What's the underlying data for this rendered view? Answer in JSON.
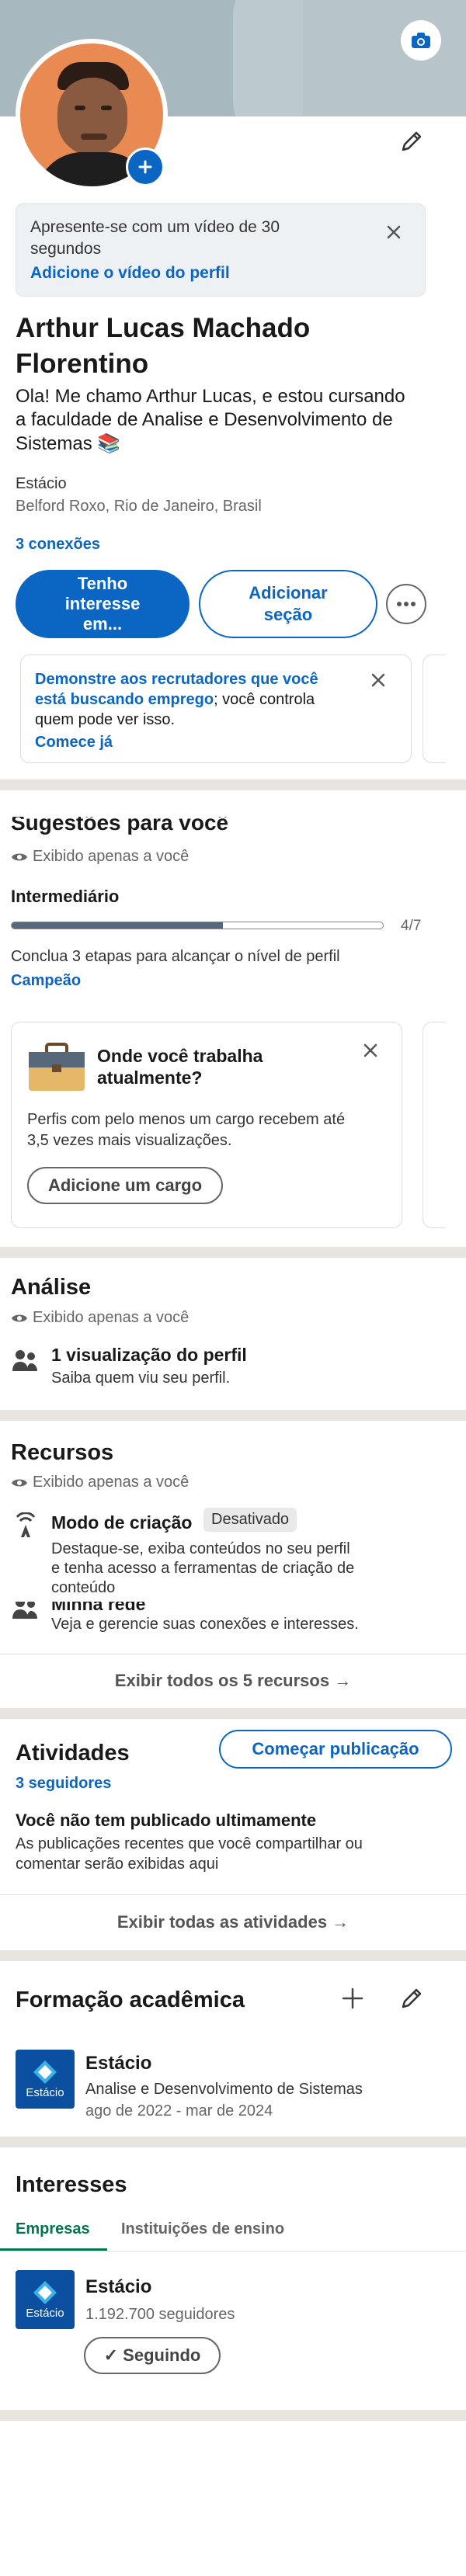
{
  "profile": {
    "name": "Arthur Lucas Machado Florentino",
    "name_line1": "Arthur Lucas Machado",
    "name_line2": "Florentino",
    "headline_line1": "Ola! Me chamo Arthur Lucas, e estou cursando",
    "headline_line2": "a faculdade de Analise e Desenvolvimento de",
    "headline_line3": "Sistemas 📚",
    "company": "Estácio",
    "location": "Belford Roxo, Rio de Janeiro, Brasil",
    "connections": "3 conexões"
  },
  "video_banner": {
    "text_line1": "Apresente-se com um vídeo de 30",
    "text_line2": "segundos",
    "link": "Adicione o vídeo do perfil"
  },
  "actions": {
    "primary_line1": "Tenho",
    "primary_line2": "interesse",
    "primary_line3": "em...",
    "secondary_line1": "Adicionar",
    "secondary_line2": "seção"
  },
  "recruiter_card": {
    "bold_line1": "Demonstre aos recrutadores que você",
    "bold_line2": "está buscando emprego",
    "rest_line2": "; você controla",
    "line3": "quem pode ver isso.",
    "link": "Comece já"
  },
  "suggestions": {
    "title": "Sugestões para você",
    "visibility": "Exibido apenas a você",
    "level": "Intermediário",
    "progress_label": "4/7",
    "progress_value": 0.57,
    "hint": "Conclua 3 etapas para alcançar o nível de perfil",
    "hint_link": "Campeão",
    "card_title_line1": "Onde você trabalha",
    "card_title_line2": "atualmente?",
    "card_body_line1": "Perfis com pelo menos um cargo recebem até",
    "card_body_line2": "3,5 vezes mais visualizações.",
    "card_button": "Adicione um cargo"
  },
  "analytics": {
    "title": "Análise",
    "visibility": "Exibido apenas a você",
    "item_title": "1 visualização do perfil",
    "item_sub": "Saiba quem viu seu perfil."
  },
  "resources": {
    "title": "Recursos",
    "visibility": "Exibido apenas a você",
    "creator_title": "Modo de criação",
    "creator_badge": "Desativado",
    "creator_desc_line1": "Destaque-se, exiba conteúdos no seu perfil",
    "creator_desc_line2": "e tenha acesso a ferramentas de criação de",
    "creator_desc_line3": "conteúdo",
    "network_title": "Minha rede",
    "network_desc": "Veja e gerencie suas conexões e interesses.",
    "show_all": "Exibir todos os 5 recursos →"
  },
  "activity": {
    "title": "Atividades",
    "followers": "3 seguidores",
    "start_post": "Começar publicação",
    "empty_title": "Você não tem publicado ultimamente",
    "empty_line1": "As publicações recentes que você compartilhar ou",
    "empty_line2": "comentar serão exibidas aqui",
    "show_all": "Exibir todas as atividades →"
  },
  "education": {
    "title": "Formação acadêmica",
    "school": "Estácio",
    "course": "Analise e Desenvolvimento de Sistemas",
    "dates": "ago de 2022 - mar de 2024",
    "logo_text": "Estácio"
  },
  "interests": {
    "title": "Interesses",
    "tabs": [
      "Empresas",
      "Instituições de ensino"
    ],
    "company": "Estácio",
    "followers": "1.192.700 seguidores",
    "following_button": "✓ Seguindo",
    "logo_text": "Estácio"
  },
  "colors": {
    "primary": "#0a66c2",
    "banner": "#a8b8bf",
    "separator": "#e8e5e0",
    "logo": "#0a4fa0"
  }
}
